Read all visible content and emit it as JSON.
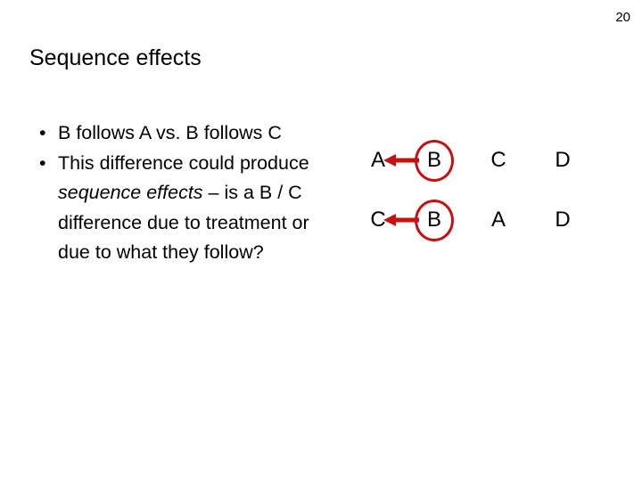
{
  "slide": {
    "page_number": "20",
    "title": "Sequence effects",
    "bullets": [
      {
        "marker": "•",
        "segments": [
          {
            "text": "B follows A vs. B follows C",
            "style": "normal"
          }
        ]
      },
      {
        "marker": "•",
        "segments": [
          {
            "text": "This difference could produce ",
            "style": "normal"
          },
          {
            "text": "sequence effects",
            "style": "italic"
          },
          {
            "text": " – is a B / C difference due to treatment or due to what they follow?",
            "style": "normal"
          }
        ]
      }
    ],
    "bullet_text_plain": [
      "B follows A vs. B follows C",
      "This difference could produce sequence effects – is a B / C difference due to treatment or due to what they follow?"
    ],
    "bullet2_prefix": "This difference could produce ",
    "bullet2_italic": "sequence effects",
    "bullet2_suffix": " – is a B / C difference due to treatment or due to what they follow?"
  },
  "diagram": {
    "accent_color": "#c41212",
    "text_color": "#000000",
    "rows": [
      {
        "label": "sequence-row-1",
        "cells": [
          {
            "letter": "A",
            "circled": false,
            "arrow_in": true
          },
          {
            "letter": "B",
            "circled": true,
            "arrow_out": true
          },
          {
            "letter": "C",
            "circled": false
          },
          {
            "letter": "D",
            "circled": false
          }
        ]
      },
      {
        "label": "sequence-row-2",
        "cells": [
          {
            "letter": "C",
            "circled": false,
            "arrow_in": true
          },
          {
            "letter": "B",
            "circled": true,
            "arrow_out": true
          },
          {
            "letter": "A",
            "circled": false
          },
          {
            "letter": "D",
            "circled": false
          }
        ]
      }
    ],
    "row_letters": [
      [
        "A",
        "B",
        "C",
        "D"
      ],
      [
        "C",
        "B",
        "A",
        "D"
      ]
    ],
    "arrow_direction": "left",
    "arrow_meaning": "B precedes / points back to the item it follows"
  }
}
